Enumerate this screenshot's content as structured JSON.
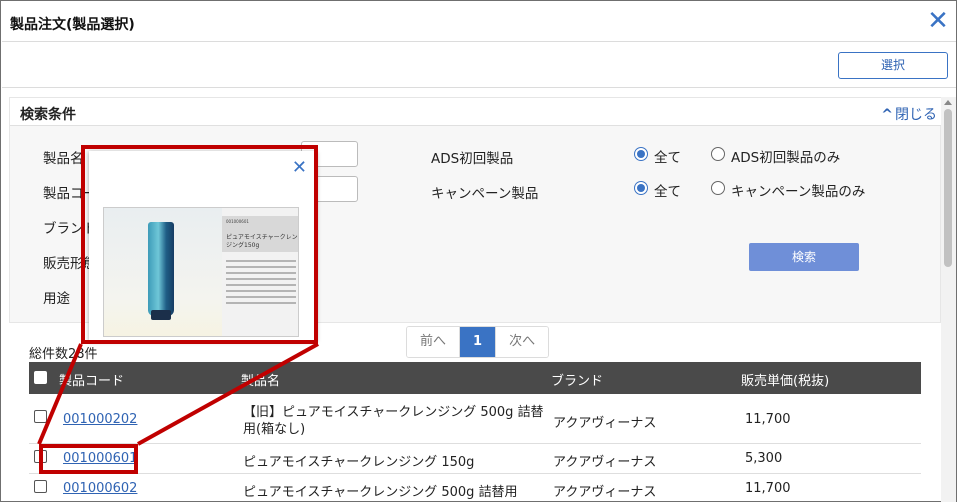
{
  "dialog": {
    "title": "製品注文(製品選択)",
    "select_label": "選択"
  },
  "search": {
    "title": "検索条件",
    "collapse_label": "閉じる",
    "labels": {
      "product_name": "製品名",
      "product_code": "製品コード",
      "brand": "ブランド",
      "sales": "販売形態",
      "usage": "用途"
    },
    "ads_first": {
      "label": "ADS初回製品",
      "options": [
        "全て",
        "ADS初回製品のみ"
      ],
      "selected": "全て"
    },
    "campaign": {
      "label": "キャンペーン製品",
      "options": [
        "全て",
        "キャンペーン製品のみ"
      ],
      "selected": "全て"
    },
    "search_label": "検索"
  },
  "pagination": {
    "prev": "前へ",
    "current": "1",
    "next": "次へ"
  },
  "results": {
    "total_label": "総件数28件",
    "columns": [
      "製品コード",
      "製品名",
      "ブランド",
      "販売単価(税抜)"
    ],
    "rows": [
      {
        "code": "001000202",
        "name": "【旧】ピュアモイスチャークレンジング 500g 詰替用(箱なし)",
        "brand": "アクアヴィーナス",
        "price": "11,700"
      },
      {
        "code": "001000601",
        "name": "ピュアモイスチャークレンジング 150g",
        "brand": "アクアヴィーナス",
        "price": "5,300"
      },
      {
        "code": "001000602",
        "name": "ピュアモイスチャークレンジング 500g 詰替用",
        "brand": "アクアヴィーナス",
        "price": "11,700"
      }
    ]
  },
  "popup": {
    "image_code": "001000601",
    "image_name": "ピュアモイスチャークレンジング150g"
  },
  "colors": {
    "accent": "#3a73c4",
    "header_bg": "#4a4a4a",
    "callout": "#c00000",
    "search_button": "#6f8fd8"
  },
  "icons": [
    "close-icon",
    "chevron-up-icon",
    "scroll-up-icon"
  ]
}
